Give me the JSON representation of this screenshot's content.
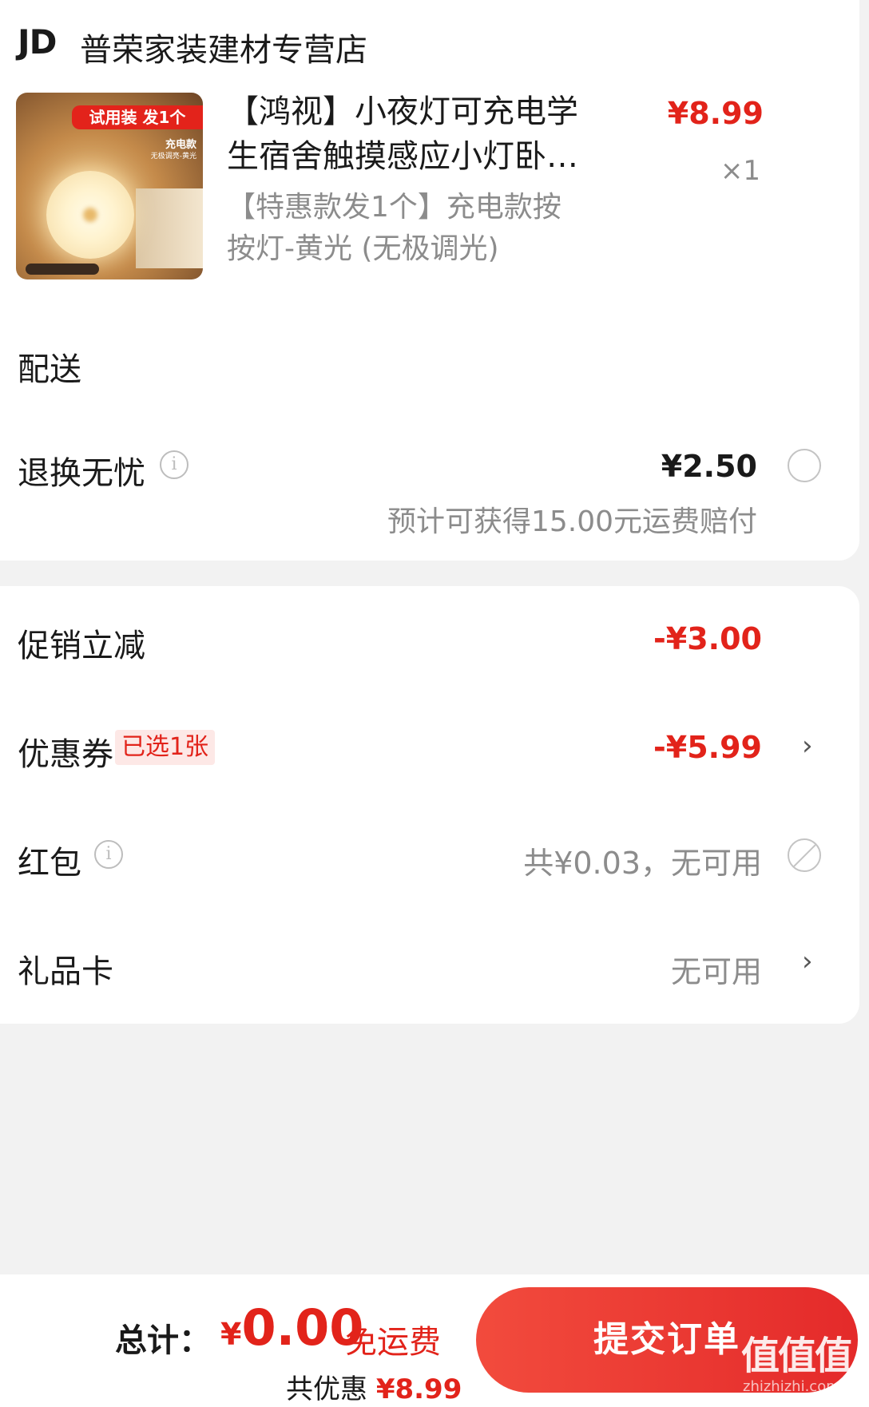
{
  "shop": {
    "logo": "JD",
    "name": "普荣家装建材专营店"
  },
  "product": {
    "image_badge": "试用装 发1个",
    "image_sub1": "充电款",
    "image_sub2": "无极调亮-黄光",
    "image_bottom_tag": "",
    "title_line1": "【鸿视】小夜灯可充电学",
    "title_line2": "生宿舍触摸感应小灯卧…",
    "spec_line1": "【特惠款发1个】充电款按",
    "spec_line2": "按灯-黄光 (无极调光)",
    "price": "¥8.99",
    "quantity": "×1"
  },
  "delivery": {
    "label": "配送"
  },
  "return_insurance": {
    "label": "退换无忧",
    "price": "¥2.50",
    "note": "预计可获得15.00元运费赔付"
  },
  "discounts": {
    "promo": {
      "label": "促销立减",
      "value": "-¥3.00"
    },
    "coupon": {
      "label": "优惠券",
      "tag": "已选1张",
      "value": "-¥5.99"
    },
    "red_packet": {
      "label": "红包",
      "value": "共¥0.03，无可用"
    },
    "gift_card": {
      "label": "礼品卡",
      "value": "无可用"
    }
  },
  "footer": {
    "total_label": "总计：",
    "currency": "¥",
    "total_amount": "0.00",
    "free_shipping": "免运费",
    "saving_label": "共优惠",
    "saving_amount": "¥8.99",
    "submit_label": "提交订单"
  },
  "watermark": {
    "text": "值值值",
    "url": "zhizhizhi.com"
  },
  "colors": {
    "accent": "#e2231a",
    "background": "#f2f2f2",
    "card": "#ffffff"
  }
}
